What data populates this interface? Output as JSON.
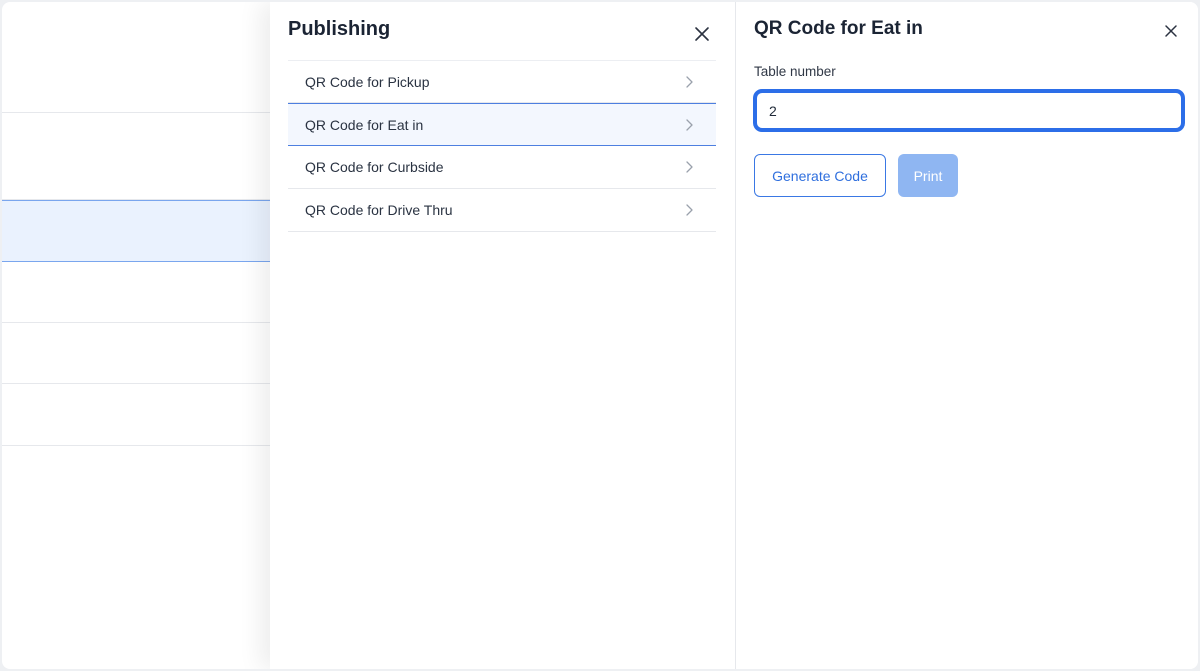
{
  "publishing": {
    "title": "Publishing",
    "items": [
      {
        "label": "QR Code for Pickup"
      },
      {
        "label": "QR Code for Eat in"
      },
      {
        "label": "QR Code for Curbside"
      },
      {
        "label": "QR Code for Drive Thru"
      }
    ],
    "active_index": 1
  },
  "detail": {
    "title": "QR Code for Eat in",
    "field_label": "Table number",
    "field_value": "2",
    "generate_label": "Generate Code",
    "print_label": "Print"
  },
  "colors": {
    "accent": "#2c6ee8",
    "print_disabled": "#8fb6f2",
    "active_row_bg": "#f3f7fe"
  },
  "icons": {
    "close": "close-icon",
    "chevron": "chevron-right-icon"
  }
}
